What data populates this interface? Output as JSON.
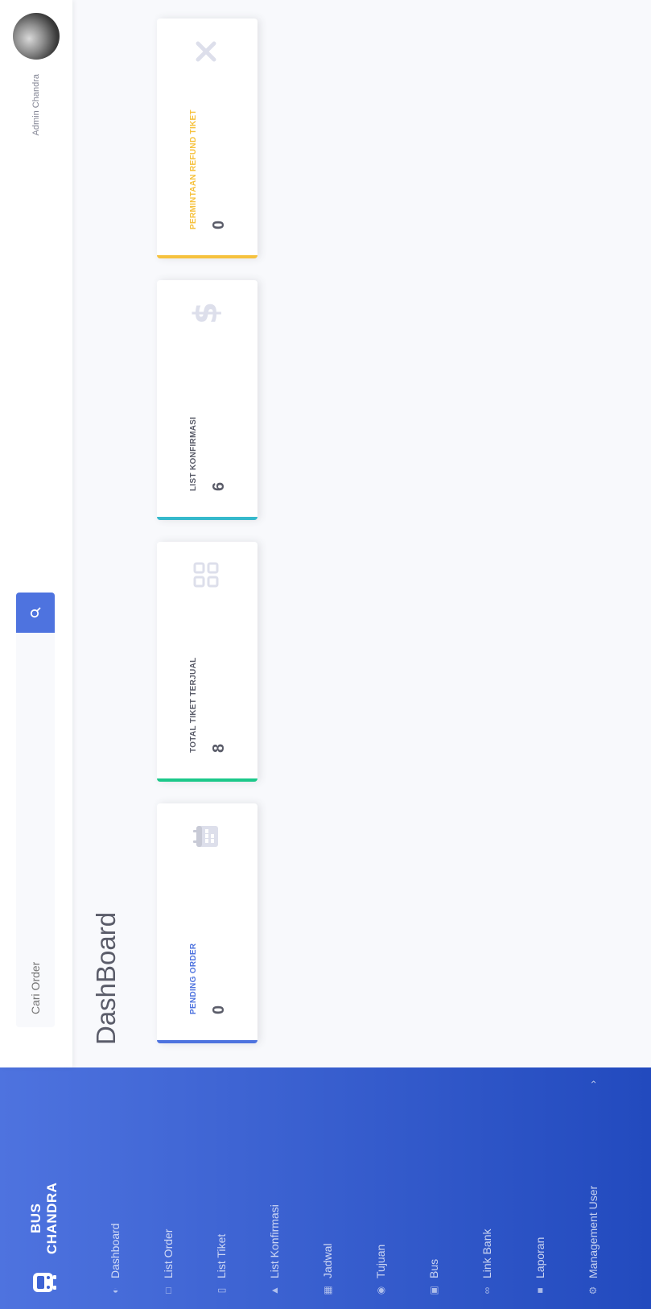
{
  "brand": {
    "line1": "BUS",
    "line2": "CHANDRA"
  },
  "sidebar": {
    "items": [
      {
        "label": "Dashboard",
        "icon": "dashboard-icon"
      },
      {
        "label": "List Order",
        "icon": "list-icon"
      },
      {
        "label": "List Tiket",
        "icon": "ticket-icon"
      },
      {
        "label": "List Konfirmasi",
        "icon": "confirm-icon"
      },
      {
        "label": "Jadwal",
        "icon": "calendar-icon"
      },
      {
        "label": "Tujuan",
        "icon": "location-icon"
      },
      {
        "label": "Bus",
        "icon": "bus-icon"
      },
      {
        "label": "Link Bank",
        "icon": "link-icon"
      },
      {
        "label": "Laporan",
        "icon": "report-icon"
      },
      {
        "label": "Management User",
        "icon": "user-cog-icon"
      }
    ]
  },
  "topbar": {
    "search_placeholder": "Cari Order",
    "user_name": "Admin Chandra"
  },
  "page": {
    "title": "DashBoard"
  },
  "cards": [
    {
      "label": "Pending Order",
      "value": "0",
      "color": "#4e73df",
      "icon": "calendar-icon"
    },
    {
      "label": "Total Tiket Terjual",
      "value": "8",
      "color": "#1cc88a",
      "icon": "grid-icon"
    },
    {
      "label": "List Konfirmasi",
      "value": "6",
      "color": "#36b9cc",
      "icon": "dollar-icon"
    },
    {
      "label": "Permintaan Refund Tiket",
      "value": "0",
      "color": "#f6c23e",
      "icon": "close-icon"
    }
  ]
}
